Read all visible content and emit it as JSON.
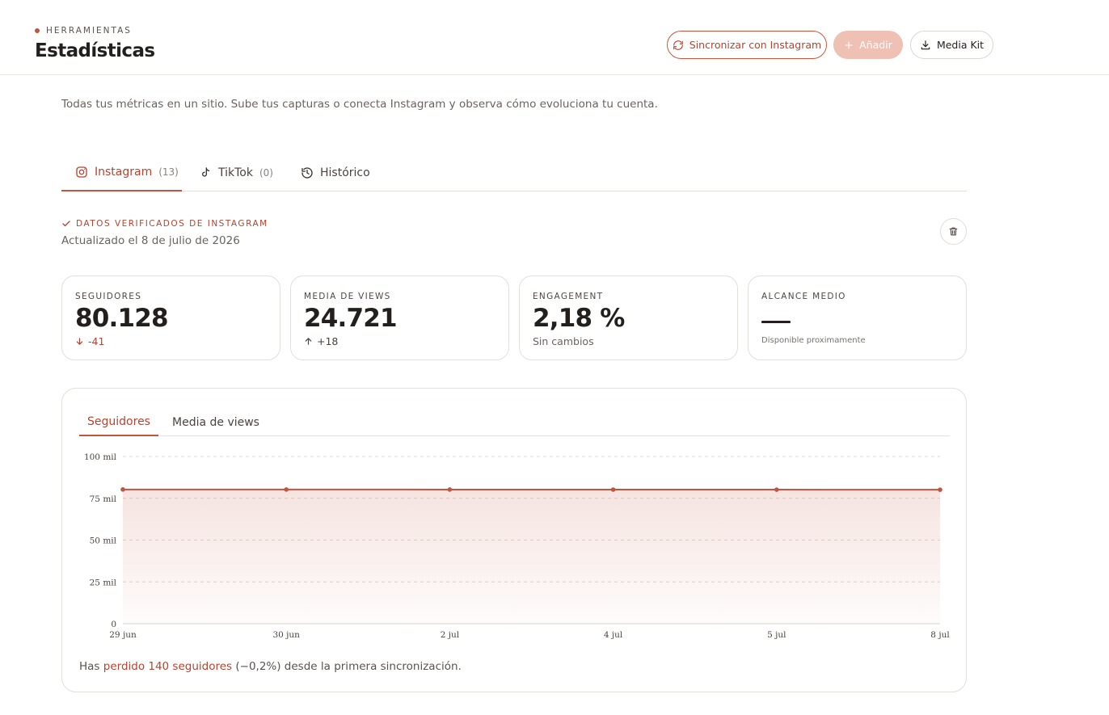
{
  "header": {
    "eyebrow": "HERRAMIENTAS",
    "title": "Estadísticas",
    "sync_label": "Sincronizar con Instagram",
    "add_label": "Añadir",
    "kit_label": "Media Kit"
  },
  "subtitle": "Todas tus métricas en un sitio. Sube tus capturas o conecta Instagram y observa cómo evoluciona tu cuenta.",
  "tabs": [
    {
      "label": "Instagram",
      "count": "(13)",
      "icon": "instagram-icon"
    },
    {
      "label": "TikTok",
      "count": "(0)",
      "icon": "tiktok-icon"
    },
    {
      "label": "Histórico",
      "icon": "history-icon"
    }
  ],
  "verified_label": "DATOS VERIFICADOS DE INSTAGRAM",
  "updated": "Actualizado el 8 de julio de 2026",
  "metrics": [
    {
      "label": "SEGUIDORES",
      "value": "80.128",
      "delta": "-41",
      "trend": "down"
    },
    {
      "label": "MEDIA DE VIEWS",
      "value": "24.721",
      "delta": "+18",
      "trend": "up"
    },
    {
      "label": "ENGAGEMENT",
      "value": "2,18 %",
      "delta": "Sin cambios",
      "trend": "flat"
    },
    {
      "label": "ALCANCE MEDIO",
      "value": "—",
      "delta": "Disponible proximamente",
      "trend": "none"
    }
  ],
  "chart_tabs": [
    "Seguidores",
    "Media de views"
  ],
  "chart_data": {
    "type": "area",
    "x": [
      "29 jun",
      "30 jun",
      "2 jul",
      "4 jul",
      "5 jul",
      "8 jul"
    ],
    "series": [
      {
        "values": [
          80268,
          80250,
          80220,
          80190,
          80169,
          80128
        ]
      }
    ],
    "yticks": [
      "0",
      "25 mil",
      "50 mil",
      "75 mil",
      "100 mil"
    ],
    "ylim": [
      0,
      100000
    ],
    "grid": true,
    "color": "#c2553f"
  },
  "summary": {
    "prefix": "Has ",
    "highlight": "perdido 140 seguidores",
    "suffix": " (−0,2%) desde la primera sincronización."
  },
  "colors": {
    "accent": "#c2553f",
    "accent_light": "#efc0b4"
  }
}
